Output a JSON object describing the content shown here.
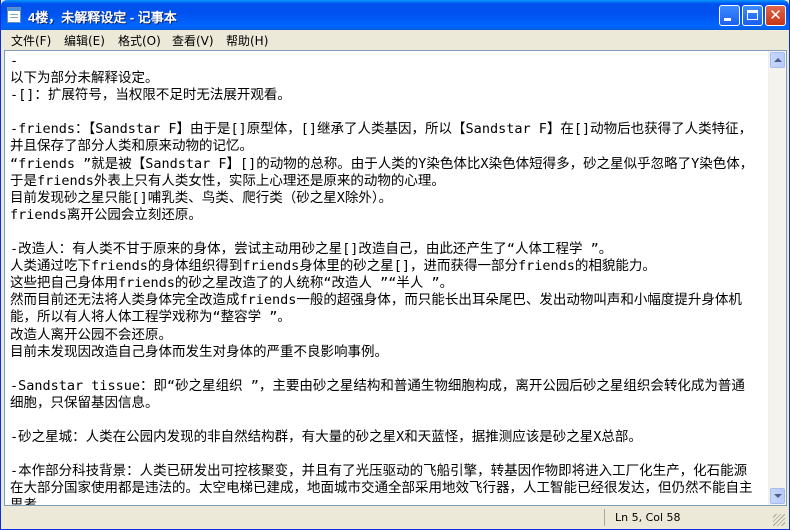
{
  "window": {
    "title": "4楼，未解释设定 - 记事本",
    "icon": "notepad-icon",
    "controls": {
      "minimize": "minimize-icon",
      "maximize": "maximize-icon",
      "close": "close-icon",
      "close_glyph": "✕"
    },
    "colors": {
      "titlebar": "#0055ea",
      "close_button": "#d2482b"
    }
  },
  "menu": [
    {
      "label": "文件(F)"
    },
    {
      "label": "编辑(E)"
    },
    {
      "label": "格式(O)"
    },
    {
      "label": "查看(V)"
    },
    {
      "label": "帮助(H)"
    }
  ],
  "editor": {
    "content": "-\n以下为部分未解释设定。\n-[]：扩展符号，当权限不足时无法展开观看。\n\n-friends：【Sandstar F】由于是[]原型体，[]继承了人类基因，所以【Sandstar F】在[]动物后也获得了人类特征，并且保存了部分人类和原来动物的记忆。\n“friends ”就是被【Sandstar F】[]的动物的总称。由于人类的Y染色体比X染色体短得多，砂之星似乎忽略了Y染色体，于是friends外表上只有人类女性，实际上心理还是原来的动物的心理。\n目前发现砂之星只能[]哺乳类、鸟类、爬行类（砂之星X除外）。\nfriends离开公园会立刻还原。\n\n-改造人：有人类不甘于原来的身体，尝试主动用砂之星[]改造自己，由此还产生了“人体工程学 ”。\n人类通过吃下friends的身体组织得到friends身体里的砂之星[]，进而获得一部分friends的相貌能力。\n这些把自己身体用friends的砂之星改造了的人统称“改造人 ”“半人 ”。\n然而目前还无法将人类身体完全改造成friends一般的超强身体，而只能长出耳朵尾巴、发出动物叫声和小幅度提升身体机能，所以有人将人体工程学戏称为“整容学 ”。\n改造人离开公园不会还原。\n目前未发现因改造自己身体而发生对身体的严重不良影响事例。\n\n-Sandstar tissue：即“砂之星组织 ”，主要由砂之星结构和普通生物细胞构成，离开公园后砂之星组织会转化成为普通细胞，只保留基因信息。\n\n-砂之星城：人类在公园内发现的非自然结构群，有大量的砂之星X和天蓝怪，据推测应该是砂之星X总部。\n\n-本作部分科技背景：人类已研发出可控核聚变，并且有了光压驱动的飞船引擎，转基因作物即将进入工厂化生产，化石能源在大部分国家使用都是违法的。太空电梯已建成，地面城市交通全部采用地效飞行器，人工智能已经很发达，但仍然不能自主思考。\n-"
  },
  "statusbar": {
    "position": "Ln 5, Col 58"
  }
}
